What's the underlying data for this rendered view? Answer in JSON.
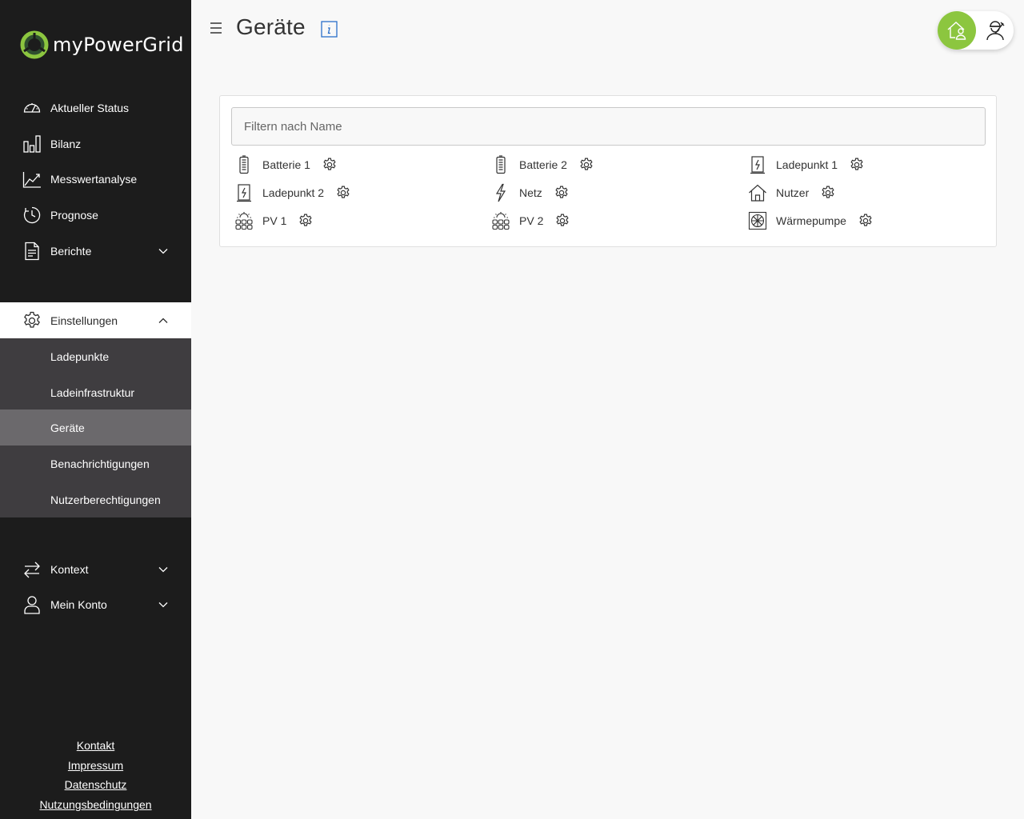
{
  "app": {
    "brand": "myPowerGrid",
    "colors": {
      "accent": "#8cc63f",
      "sidebar": "#1c1c1c",
      "submenu": "#3f3d40",
      "submenu_selected": "#6b696c"
    }
  },
  "sidebar": {
    "items": [
      {
        "label": "Aktueller Status",
        "icon": "speedometer-icon"
      },
      {
        "label": "Bilanz",
        "icon": "bar-chart-icon"
      },
      {
        "label": "Messwertanalyse",
        "icon": "line-chart-icon"
      },
      {
        "label": "Prognose",
        "icon": "clock-forecast-icon"
      },
      {
        "label": "Berichte",
        "icon": "document-icon"
      },
      {
        "label": "Einstellungen",
        "icon": "gear-icon"
      },
      {
        "label": "Kontext",
        "icon": "swap-arrows-icon"
      },
      {
        "label": "Mein Konto",
        "icon": "user-icon"
      }
    ],
    "settings_sub": [
      {
        "label": "Ladepunkte"
      },
      {
        "label": "Ladeinfrastruktur"
      },
      {
        "label": "Geräte"
      },
      {
        "label": "Benachrichtigungen"
      },
      {
        "label": "Nutzerberechtigungen"
      }
    ],
    "footer": [
      {
        "label": "Kontakt"
      },
      {
        "label": "Impressum"
      },
      {
        "label": "Datenschutz"
      },
      {
        "label": "Nutzungsbedingungen"
      }
    ]
  },
  "header": {
    "title": "Geräte",
    "info_icon": "info-icon",
    "roles": [
      "house-user-icon",
      "technician-icon"
    ]
  },
  "main": {
    "filter": {
      "placeholder": "Filtern nach Name",
      "value": ""
    },
    "devices": [
      {
        "name": "Batterie 1",
        "icon": "battery-icon"
      },
      {
        "name": "Batterie 2",
        "icon": "battery-icon"
      },
      {
        "name": "Ladepunkt 1",
        "icon": "charging-station-icon"
      },
      {
        "name": "Ladepunkt 2",
        "icon": "charging-station-icon"
      },
      {
        "name": "Netz",
        "icon": "lightning-icon"
      },
      {
        "name": "Nutzer",
        "icon": "house-icon"
      },
      {
        "name": "PV 1",
        "icon": "solar-panel-icon"
      },
      {
        "name": "PV 2",
        "icon": "solar-panel-icon"
      },
      {
        "name": "Wärmepumpe",
        "icon": "heat-pump-icon"
      }
    ]
  }
}
